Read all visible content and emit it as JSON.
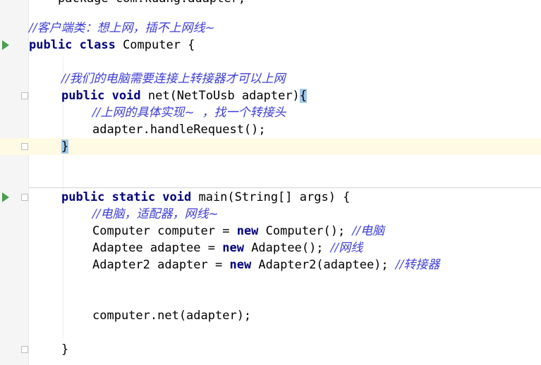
{
  "editor": {
    "language": "java",
    "lines": {
      "top_cut": "package com.kuang.adapter;",
      "class_comment": "//客户端类：想上网，插不上网线~",
      "class_decl": {
        "kw": "public class",
        "rest": " Computer {"
      },
      "net_comment": "//我们的电脑需要连接上转接器才可以上网",
      "net_decl": {
        "kw1": "public",
        "kw2": "void",
        "rest": " net(NetToUsb adapter)",
        "brace": "{"
      },
      "net_body_comment": "//上网的具体实现~  ，找一个转接头",
      "net_call": "adapter.handleRequest();",
      "net_close": "}",
      "main_decl": {
        "kw": "public static void",
        "rest": " main(String[] args) {"
      },
      "main_comment": "//电脑，适配器，网线~",
      "line_computer": {
        "code_a": "Computer computer = ",
        "kw": "new",
        "code_b": " Computer(); ",
        "comment": "//电脑"
      },
      "line_adaptee": {
        "code_a": "Adaptee adaptee = ",
        "kw": "new",
        "code_b": " Adaptee(); ",
        "comment": "//网线"
      },
      "line_adapter2": {
        "code_a": "Adapter2 adapter = ",
        "kw": "new",
        "code_b": " Adapter2(adaptee); ",
        "comment": "//转接器"
      },
      "net_invoke": "computer.net(adapter);",
      "main_close": "}"
    }
  },
  "colors": {
    "keyword": "#000080",
    "comment": "#3d3dd8",
    "caret_line": "#fffae3",
    "brace_match": "#9fc7ea",
    "run_icon": "#4c9f52"
  },
  "icons": [
    "run-arrow-icon",
    "fold-marker-icon"
  ]
}
